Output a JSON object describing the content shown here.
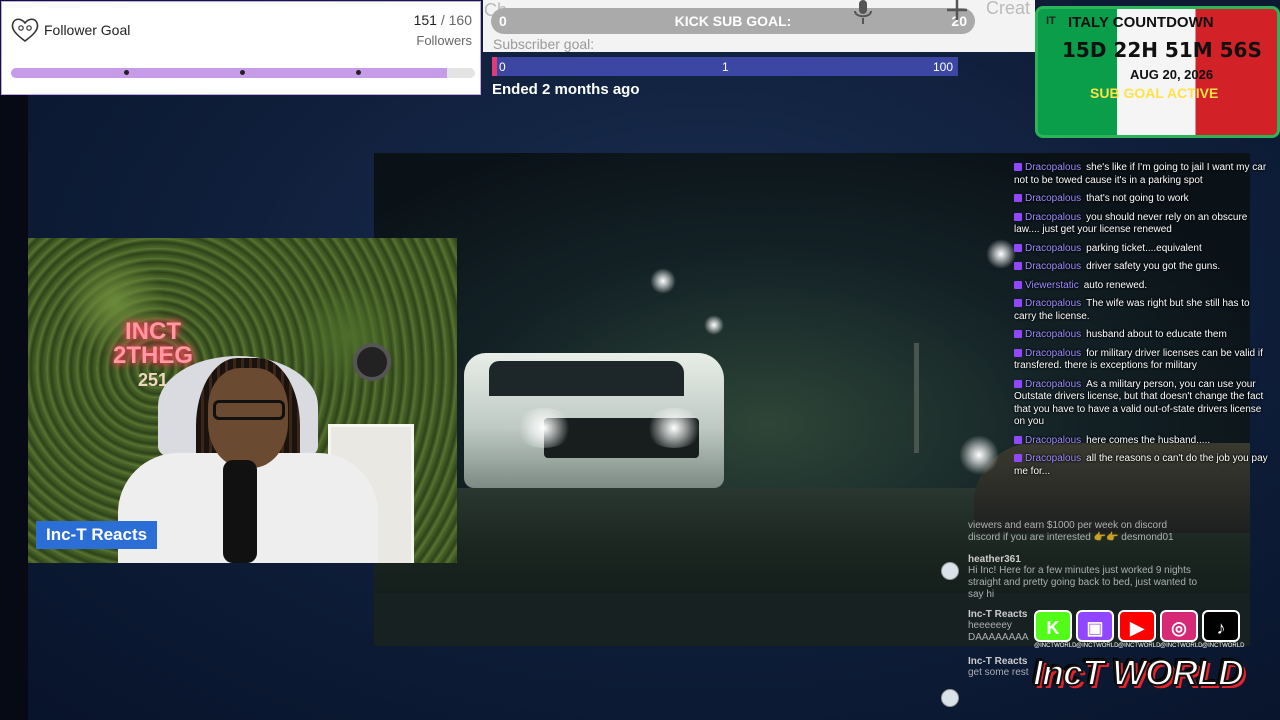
{
  "follower_goal": {
    "title": "Follower Goal",
    "current": "151",
    "separator": " / ",
    "target": "160",
    "unit": "Followers",
    "progress": 0.94
  },
  "top_strip": {
    "ghost_text_left": "Ch",
    "ghost_text_right": "Creat",
    "kick_goal": {
      "label": "KICK SUB GOAL:",
      "min": "0",
      "max": "20"
    }
  },
  "subscriber_goal": {
    "caption": "Subscriber goal:",
    "start": "0",
    "current": "1",
    "target": "100",
    "status": "Ended 2 months ago"
  },
  "italy_countdown": {
    "flag_code": "IT",
    "title": "ITALY COUNTDOWN",
    "time": "15D 22H 51M 56S",
    "date": "AUG 20, 2026",
    "status": "SUB GOAL ACTIVE",
    "colors": {
      "green": "#0a9d4a",
      "white": "#f5f5f5",
      "red": "#d32128"
    }
  },
  "chat": {
    "messages": [
      {
        "user": "Dracopalous",
        "text": "she's like if I'm going to jail I want my car not to be towed cause it's in a parking spot"
      },
      {
        "user": "Dracopalous",
        "text": "that's not going to work"
      },
      {
        "user": "Dracopalous",
        "text": "you should never rely on an obscure law.... just get your license renewed"
      },
      {
        "user": "Dracopalous",
        "text": "parking ticket....equivalent"
      },
      {
        "user": "Dracopalous",
        "text": "driver safety you got the guns."
      },
      {
        "user": "Viewerstatic",
        "text": "auto renewed."
      },
      {
        "user": "Dracopalous",
        "text": "The wife was right but she still has to carry the license."
      },
      {
        "user": "Dracopalous",
        "text": "husband about to educate them"
      },
      {
        "user": "Dracopalous",
        "text": "for military driver licenses can be valid if transfered. there is exceptions for military"
      },
      {
        "user": "Dracopalous",
        "text": "As a military person, you can use your Outstate drivers license, but that doesn't change the fact that you have to have a valid out-of-state drivers license on you"
      },
      {
        "user": "Dracopalous",
        "text": "here comes the husband....."
      },
      {
        "user": "Dracopalous",
        "text": "all the reasons o can't do the job you pay me for..."
      }
    ]
  },
  "yt_chat": {
    "ticker": "viewers and earn $1000 per week on discord",
    "ticker2": "discord if you are interested 👉👉 desmond01",
    "messages": [
      {
        "user": "heather361",
        "text": "Hi Inc! Here for a few minutes just worked 9 nights straight and pretty going back to bed, just wanted to say hi"
      },
      {
        "user": "Inc-T Reacts",
        "text": "heeeeeey DAAAAAAAA"
      },
      {
        "user": "Inc-T Reacts",
        "text": "get some rest"
      }
    ]
  },
  "webcam": {
    "sign_line1": "INCT",
    "sign_line2": "2THEG",
    "sign_line3": "251",
    "label": "Inc-T Reacts"
  },
  "socials": {
    "items": [
      {
        "icon": "kick-icon",
        "glyph": "K",
        "color": "#53fc18",
        "caption": "@INCTWORLD"
      },
      {
        "icon": "twitch-icon",
        "glyph": "▣",
        "color": "#9146ff",
        "caption": "@INCTWORLD"
      },
      {
        "icon": "youtube-icon",
        "glyph": "▶",
        "color": "#ff0000",
        "caption": "@INCTWORLD"
      },
      {
        "icon": "instagram-icon",
        "glyph": "◎",
        "color": "#d62976",
        "caption": "@INCTWORLD"
      },
      {
        "icon": "tiktok-icon",
        "glyph": "♪",
        "color": "#000000",
        "caption": "@INCTWORLD"
      }
    ],
    "brand": "IncT WORLD"
  }
}
